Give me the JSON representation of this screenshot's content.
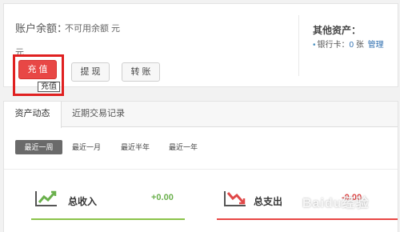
{
  "account": {
    "balance_label": "账户余额：",
    "unavailable_note": "不可用余额 元",
    "balance_unit": "元"
  },
  "actions": {
    "recharge": "充 值",
    "withdraw": "提 现",
    "transfer": "转 账",
    "tooltip": "充值"
  },
  "other_assets": {
    "title": "其他资产：",
    "bank_label": "银行卡：",
    "bank_count": "0",
    "bank_unit": "张",
    "manage_link": "管理"
  },
  "tabs": [
    {
      "label": "资产动态"
    },
    {
      "label": "近期交易记录"
    }
  ],
  "filters": [
    {
      "label": "最近一周"
    },
    {
      "label": "最近一月"
    },
    {
      "label": "最近半年"
    },
    {
      "label": "最近一年"
    }
  ],
  "summary": {
    "income_label": "总收入",
    "income_value": "+0.00",
    "expense_label": "总支出",
    "expense_value": "-0.00"
  },
  "watermark": "Baidu经验",
  "colors": {
    "primary": "#e84745",
    "income": "#6ab04c",
    "expense": "#e04848",
    "link": "#2f6fb0"
  }
}
